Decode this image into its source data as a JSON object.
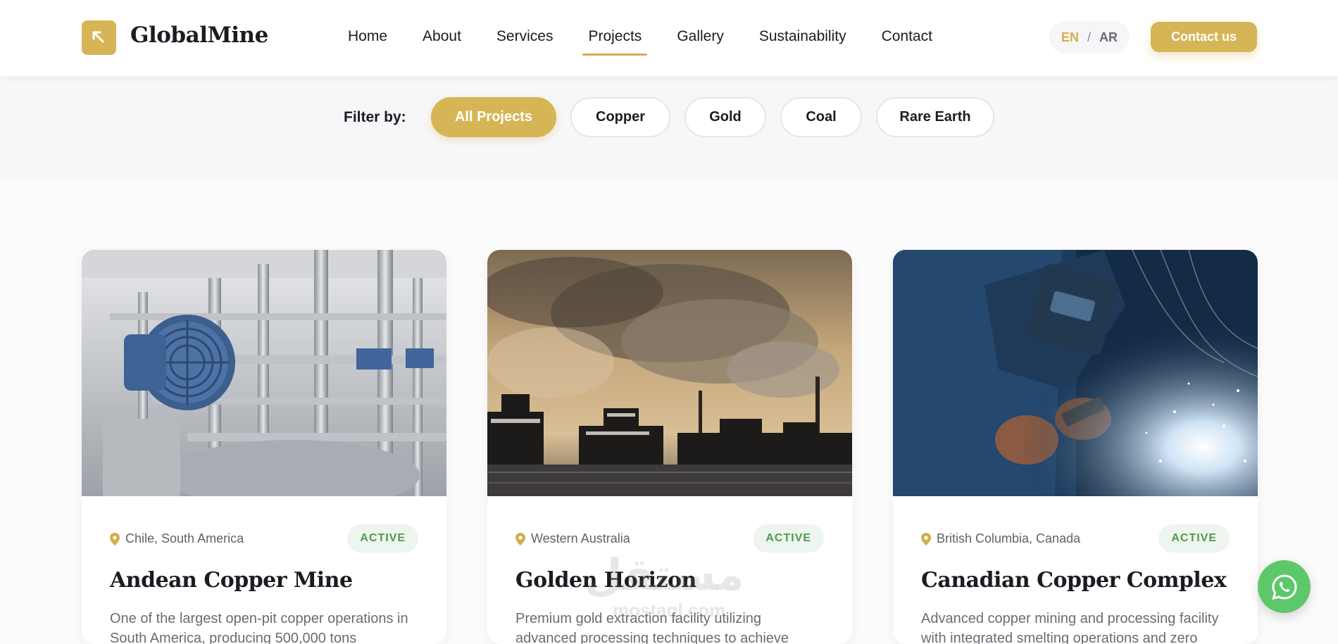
{
  "brand": {
    "name": "GlobalMine",
    "logo_icon": "pickaxe-icon",
    "accent": "#d6b556"
  },
  "nav": {
    "items": [
      {
        "label": "Home",
        "active": false
      },
      {
        "label": "About",
        "active": false
      },
      {
        "label": "Services",
        "active": false
      },
      {
        "label": "Projects",
        "active": true
      },
      {
        "label": "Gallery",
        "active": false
      },
      {
        "label": "Sustainability",
        "active": false
      },
      {
        "label": "Contact",
        "active": false
      }
    ],
    "lang": {
      "en": "EN",
      "sep": "/",
      "ar": "AR"
    },
    "contact_label": "Contact us"
  },
  "filter": {
    "label": "Filter by:",
    "options": [
      {
        "label": "All Projects",
        "active": true
      },
      {
        "label": "Copper",
        "active": false
      },
      {
        "label": "Gold",
        "active": false
      },
      {
        "label": "Coal",
        "active": false
      },
      {
        "label": "Rare Earth",
        "active": false
      }
    ]
  },
  "projects": [
    {
      "location": "Chile, South America",
      "status": "ACTIVE",
      "title": "Andean Copper Mine",
      "description": "One of the largest open-pit copper operations in South America, producing 500,000 tons",
      "image": "industrial-pipes-photo"
    },
    {
      "location": "Western Australia",
      "status": "ACTIVE",
      "title": "Golden Horizon",
      "description": "Premium gold extraction facility utilizing advanced processing techniques to achieve",
      "image": "smokestack-port-photo"
    },
    {
      "location": "British Columbia, Canada",
      "status": "ACTIVE",
      "title": "Canadian Copper Complex",
      "description": "Advanced copper mining and processing facility with integrated smelting operations and zero",
      "image": "welder-sparks-photo"
    }
  ],
  "watermark": {
    "arabic": "مستقل",
    "latin": "mostaql.com"
  },
  "whatsapp_icon": "whatsapp-icon"
}
